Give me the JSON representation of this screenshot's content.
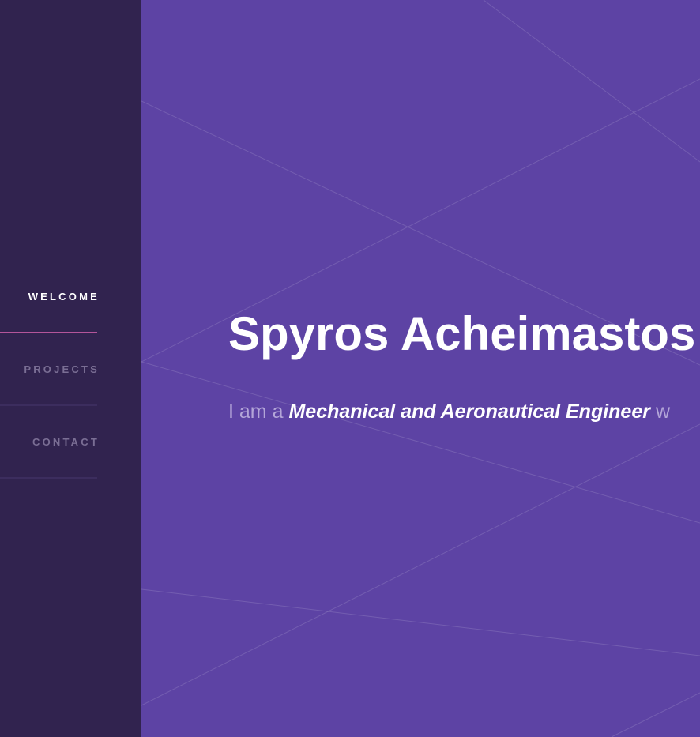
{
  "nav": {
    "items": [
      {
        "label": "WELCOME",
        "active": true
      },
      {
        "label": "PROJECTS",
        "active": false
      },
      {
        "label": "CONTACT",
        "active": false
      }
    ]
  },
  "hero": {
    "name": "Spyros Acheimastos",
    "tagline_prefix": "I am a",
    "tagline_role": "Mechanical and Aeronautical Engineer",
    "tagline_suffix": "w"
  },
  "colors": {
    "sidebar_bg": "#31234f",
    "main_bg": "#5d43a4",
    "active_accent": "#b4559a",
    "nav_inactive_text": "#7a6e94",
    "tagline_text": "#b3a5d8"
  }
}
